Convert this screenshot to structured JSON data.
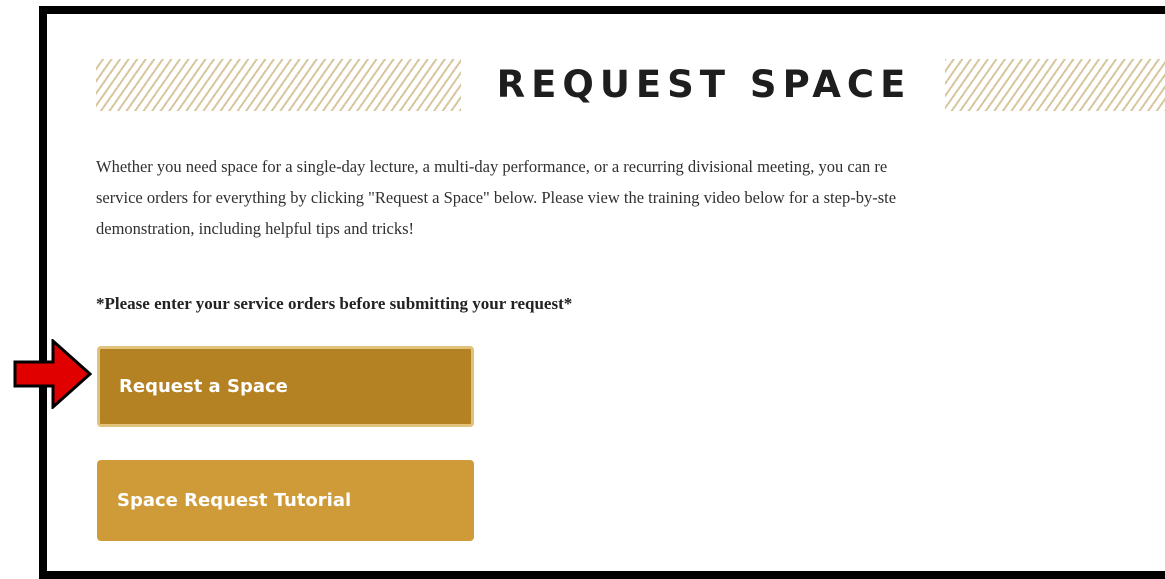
{
  "header": {
    "title": "REQUEST SPACE"
  },
  "intro": {
    "line1": "Whether you need space for a single-day lecture, a multi-day performance, or a recurring divisional meeting, you can re",
    "line2": "service orders for everything by clicking \"Request a Space\" below.  Please view the training video below for a step-by-ste",
    "line3": "demonstration, including helpful tips and tricks!"
  },
  "notice": "*Please enter your service orders before submitting your request*",
  "buttons": {
    "request": "Request a Space",
    "tutorial": "Space Request Tutorial"
  },
  "colors": {
    "request_button": "#b48123",
    "request_button_border": "#e1c27b",
    "tutorial_button": "#cf9b38",
    "hatch": "#d8c79e",
    "arrow": "#e10000"
  },
  "icons": {
    "pointer": "red-arrow-icon"
  }
}
